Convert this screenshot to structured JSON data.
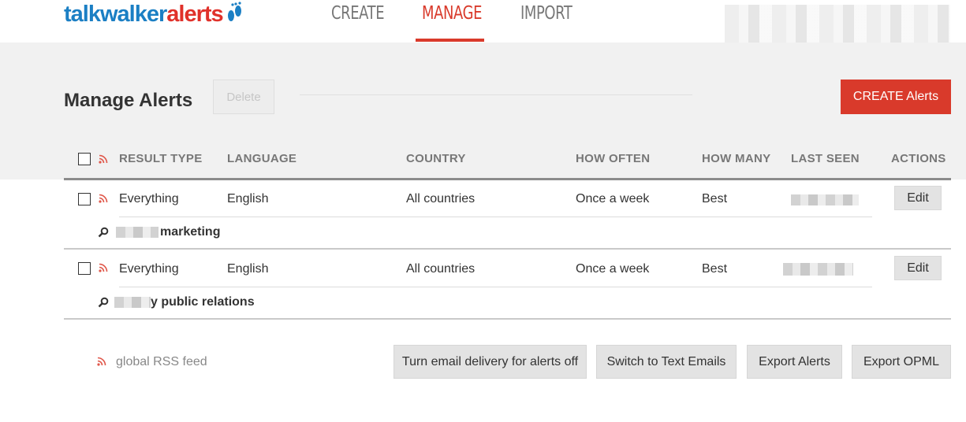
{
  "logo": {
    "part1": "talkwalker",
    "part2": "alerts"
  },
  "nav": {
    "create": "CREATE",
    "manage": "MANAGE",
    "import": "IMPORT"
  },
  "page": {
    "title": "Manage Alerts",
    "delete_label": "Delete",
    "create_label": "CREATE Alerts"
  },
  "table": {
    "headers": [
      "RESULT TYPE",
      "LANGUAGE",
      "COUNTRY",
      "HOW OFTEN",
      "HOW MANY",
      "LAST SEEN",
      "ACTIONS"
    ],
    "rows": [
      {
        "result_type": "Everything",
        "language": "English",
        "country": "All countries",
        "how_often": "Once a week",
        "how_many": "Best",
        "edit": "Edit",
        "keyword": "marketing"
      },
      {
        "result_type": "Everything",
        "language": "English",
        "country": "All countries",
        "how_often": "Once a week",
        "how_many": "Best",
        "edit": "Edit",
        "keyword": "y public relations"
      }
    ]
  },
  "footer": {
    "rss_label": "global RSS feed",
    "buttons": [
      "Turn email delivery for alerts off",
      "Switch to Text Emails",
      "Export Alerts",
      "Export OPML"
    ]
  },
  "colors": {
    "brand_blue": "#1b7fc4",
    "brand_red": "#d93a2b",
    "band": "#f1f1f1"
  },
  "icons": {
    "rss": "rss-icon",
    "search": "search-icon",
    "logo_feet": "footprint-icon"
  }
}
